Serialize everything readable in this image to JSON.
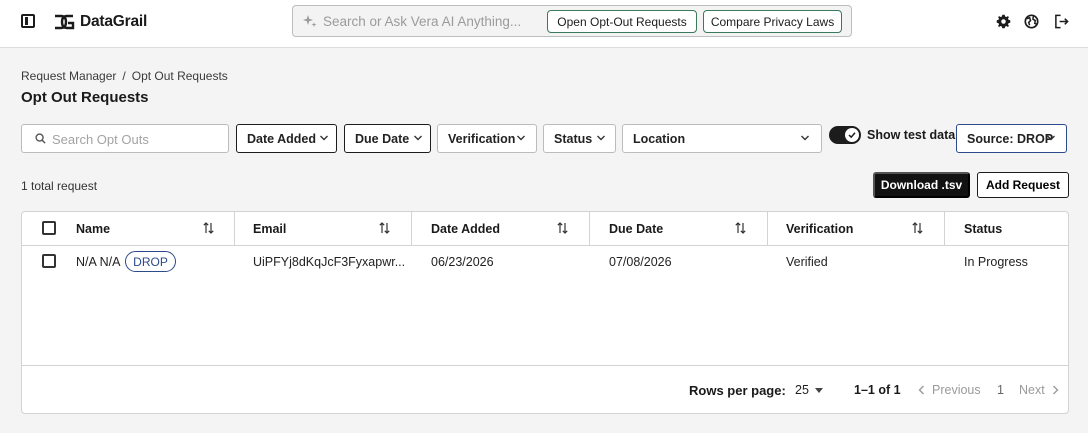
{
  "app": {
    "name": "DataGrail"
  },
  "search": {
    "placeholder": "Search or Ask Vera AI Anything...",
    "quick_buttons": [
      "Open Opt-Out Requests",
      "Compare Privacy Laws"
    ]
  },
  "header_icons": [
    "settings-gear-icon",
    "globe-icon",
    "logout-icon"
  ],
  "breadcrumb": [
    "Request Manager",
    "/",
    "Opt Out Requests"
  ],
  "page_title": "Opt Out Requests",
  "filters": {
    "search_placeholder": "Search Opt Outs",
    "date_added": "Date Added",
    "due_date": "Due Date",
    "verification": "Verification",
    "status": "Status",
    "location": "Location",
    "show_test_data_label": "Show test data",
    "show_test_data_on": true,
    "source": "Source: DROP"
  },
  "summary": {
    "total": "1 total request",
    "download_label": "Download .tsv",
    "add_label": "Add Request"
  },
  "table": {
    "columns": [
      "Name",
      "Email",
      "Date Added",
      "Due Date",
      "Verification",
      "Status"
    ],
    "rows": [
      {
        "name": "N/A N/A",
        "badge": "DROP",
        "email": "UiPFYj8dKqJcF3Fyxapwr...",
        "date_added": "06/23/2026",
        "due_date": "07/08/2026",
        "verification": "Verified",
        "status": "In Progress"
      }
    ]
  },
  "pagination": {
    "rows_per_page_label": "Rows per page:",
    "rows_per_page": "25",
    "range": "1–1 of 1",
    "previous": "Previous",
    "page": "1",
    "next": "Next"
  },
  "colors": {
    "accent_green": "#3a7a5c",
    "accent_blue": "#2c4a8c",
    "primary_dark": "#121212"
  }
}
